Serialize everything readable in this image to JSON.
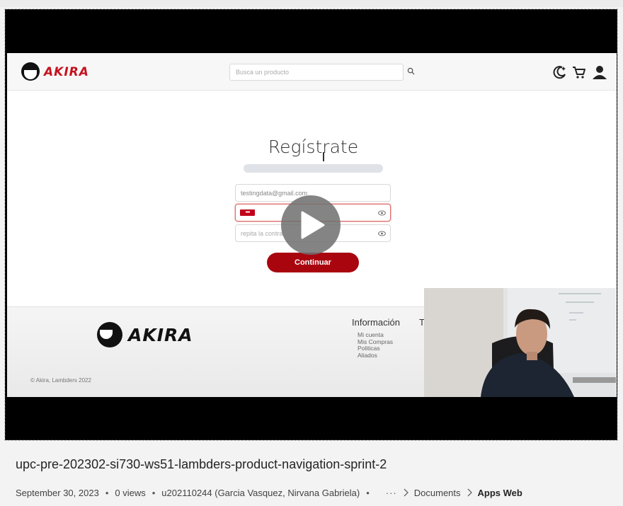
{
  "site": {
    "brand": "AKIRA",
    "search_placeholder": "Busca un producto",
    "icons": [
      "theme-toggle-icon",
      "cart-icon",
      "user-icon",
      "search-icon"
    ]
  },
  "register": {
    "title": "Regístrate",
    "email_value": "testingdata@gmail.com",
    "password_masked": "••••",
    "repeat_placeholder": "repita la contra",
    "continue_label": "Continuar"
  },
  "footer": {
    "heading": "Información",
    "heading_2": "Ti",
    "links": [
      "Mi cuenta",
      "Mis Compras",
      "Politicas",
      "Aliados"
    ],
    "copyright": "© Akira, Lambders 2022"
  },
  "video": {
    "title": "upc-pre-202302-si730-ws51-lambders-product-navigation-sprint-2",
    "date": "September 30, 2023",
    "views": "0 views",
    "author": "u202110244 (Garcia Vasquez, Nirvana Gabriela)",
    "more": "···",
    "breadcrumb": [
      "Documents",
      "Apps Web"
    ]
  },
  "colors": {
    "brand_red": "#a9050f",
    "player_bg": "#000000",
    "page_bg": "#f3f3f3"
  }
}
